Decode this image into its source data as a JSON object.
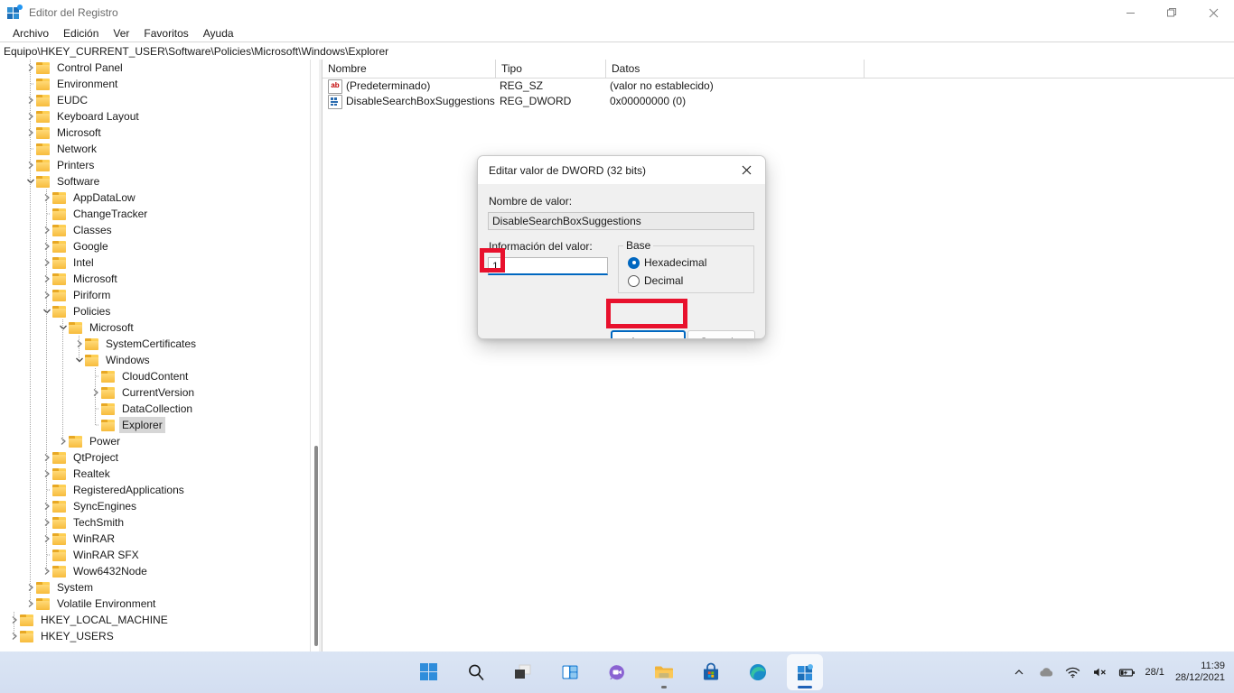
{
  "window": {
    "title": "Editor del Registro",
    "icon": "registry-icon",
    "controls": {
      "minimize": "minimize-icon",
      "maximize": "maximize-icon",
      "close": "close-icon"
    }
  },
  "menubar": {
    "items": [
      "Archivo",
      "Edición",
      "Ver",
      "Favoritos",
      "Ayuda"
    ]
  },
  "address": {
    "path": "Equipo\\HKEY_CURRENT_USER\\Software\\Policies\\Microsoft\\Windows\\Explorer"
  },
  "tree": {
    "nodes": [
      {
        "label": "Control Panel",
        "depth": 2,
        "twisty": "collapsed",
        "selected": false
      },
      {
        "label": "Environment",
        "depth": 2,
        "twisty": "none",
        "selected": false
      },
      {
        "label": "EUDC",
        "depth": 2,
        "twisty": "collapsed",
        "selected": false
      },
      {
        "label": "Keyboard Layout",
        "depth": 2,
        "twisty": "collapsed",
        "selected": false
      },
      {
        "label": "Microsoft",
        "depth": 2,
        "twisty": "collapsed",
        "selected": false
      },
      {
        "label": "Network",
        "depth": 2,
        "twisty": "none",
        "selected": false
      },
      {
        "label": "Printers",
        "depth": 2,
        "twisty": "collapsed",
        "selected": false
      },
      {
        "label": "Software",
        "depth": 2,
        "twisty": "expanded",
        "selected": false
      },
      {
        "label": "AppDataLow",
        "depth": 3,
        "twisty": "collapsed",
        "selected": false
      },
      {
        "label": "ChangeTracker",
        "depth": 3,
        "twisty": "none",
        "selected": false
      },
      {
        "label": "Classes",
        "depth": 3,
        "twisty": "collapsed",
        "selected": false
      },
      {
        "label": "Google",
        "depth": 3,
        "twisty": "collapsed",
        "selected": false
      },
      {
        "label": "Intel",
        "depth": 3,
        "twisty": "collapsed",
        "selected": false
      },
      {
        "label": "Microsoft",
        "depth": 3,
        "twisty": "collapsed",
        "selected": false
      },
      {
        "label": "Piriform",
        "depth": 3,
        "twisty": "collapsed",
        "selected": false
      },
      {
        "label": "Policies",
        "depth": 3,
        "twisty": "expanded",
        "selected": false
      },
      {
        "label": "Microsoft",
        "depth": 4,
        "twisty": "expanded",
        "selected": false
      },
      {
        "label": "SystemCertificates",
        "depth": 5,
        "twisty": "collapsed",
        "selected": false
      },
      {
        "label": "Windows",
        "depth": 5,
        "twisty": "expanded",
        "selected": false
      },
      {
        "label": "CloudContent",
        "depth": 6,
        "twisty": "none",
        "selected": false
      },
      {
        "label": "CurrentVersion",
        "depth": 6,
        "twisty": "collapsed",
        "selected": false
      },
      {
        "label": "DataCollection",
        "depth": 6,
        "twisty": "none",
        "selected": false
      },
      {
        "label": "Explorer",
        "depth": 6,
        "twisty": "none",
        "selected": true
      },
      {
        "label": "Power",
        "depth": 4,
        "twisty": "collapsed",
        "selected": false
      },
      {
        "label": "QtProject",
        "depth": 3,
        "twisty": "collapsed",
        "selected": false
      },
      {
        "label": "Realtek",
        "depth": 3,
        "twisty": "collapsed",
        "selected": false
      },
      {
        "label": "RegisteredApplications",
        "depth": 3,
        "twisty": "none",
        "selected": false
      },
      {
        "label": "SyncEngines",
        "depth": 3,
        "twisty": "collapsed",
        "selected": false
      },
      {
        "label": "TechSmith",
        "depth": 3,
        "twisty": "collapsed",
        "selected": false
      },
      {
        "label": "WinRAR",
        "depth": 3,
        "twisty": "collapsed",
        "selected": false
      },
      {
        "label": "WinRAR SFX",
        "depth": 3,
        "twisty": "none",
        "selected": false
      },
      {
        "label": "Wow6432Node",
        "depth": 3,
        "twisty": "collapsed",
        "selected": false
      },
      {
        "label": "System",
        "depth": 2,
        "twisty": "collapsed",
        "selected": false
      },
      {
        "label": "Volatile Environment",
        "depth": 2,
        "twisty": "collapsed",
        "selected": false
      },
      {
        "label": "HKEY_LOCAL_MACHINE",
        "depth": 1,
        "twisty": "collapsed",
        "selected": false
      },
      {
        "label": "HKEY_USERS",
        "depth": 1,
        "twisty": "collapsed",
        "selected": false
      }
    ]
  },
  "list": {
    "columns": [
      "Nombre",
      "Tipo",
      "Datos"
    ],
    "rows": [
      {
        "icon": "string-value-icon",
        "name": "(Predeterminado)",
        "type": "REG_SZ",
        "data": "(valor no establecido)"
      },
      {
        "icon": "dword-value-icon",
        "name": "DisableSearchBoxSuggestions",
        "type": "REG_DWORD",
        "data": "0x00000000 (0)"
      }
    ]
  },
  "dialog": {
    "title": "Editar valor de DWORD (32 bits)",
    "close_icon": "close-icon",
    "name_label": "Nombre de valor:",
    "name_value": "DisableSearchBoxSuggestions",
    "data_label": "Información del valor:",
    "data_value": "1",
    "base_group": "Base",
    "base_options": [
      {
        "label": "Hexadecimal",
        "selected": true
      },
      {
        "label": "Decimal",
        "selected": false
      }
    ],
    "ok_label": "Aceptar",
    "cancel_label": "Cancelar",
    "highlight_color": "#e8112d"
  },
  "taskbar": {
    "buttons": [
      {
        "name": "start-button",
        "icon": "windows-logo-icon"
      },
      {
        "name": "search-button",
        "icon": "search-icon"
      },
      {
        "name": "task-view-button",
        "icon": "task-view-icon"
      },
      {
        "name": "widgets-button",
        "icon": "widgets-icon"
      },
      {
        "name": "chat-button",
        "icon": "chat-icon"
      },
      {
        "name": "file-explorer-button",
        "icon": "folder-icon"
      },
      {
        "name": "microsoft-store-button",
        "icon": "store-icon"
      },
      {
        "name": "edge-button",
        "icon": "edge-icon"
      },
      {
        "name": "registry-editor-button",
        "icon": "registry-icon"
      }
    ],
    "tray": {
      "chevron": "chevron-up-icon",
      "onedrive": "cloud-icon",
      "network": "wifi-icon",
      "volume": "volume-muted-icon",
      "battery": "battery-charging-icon",
      "extra": "28/1",
      "time": "11:39",
      "date": "28/12/2021"
    }
  }
}
